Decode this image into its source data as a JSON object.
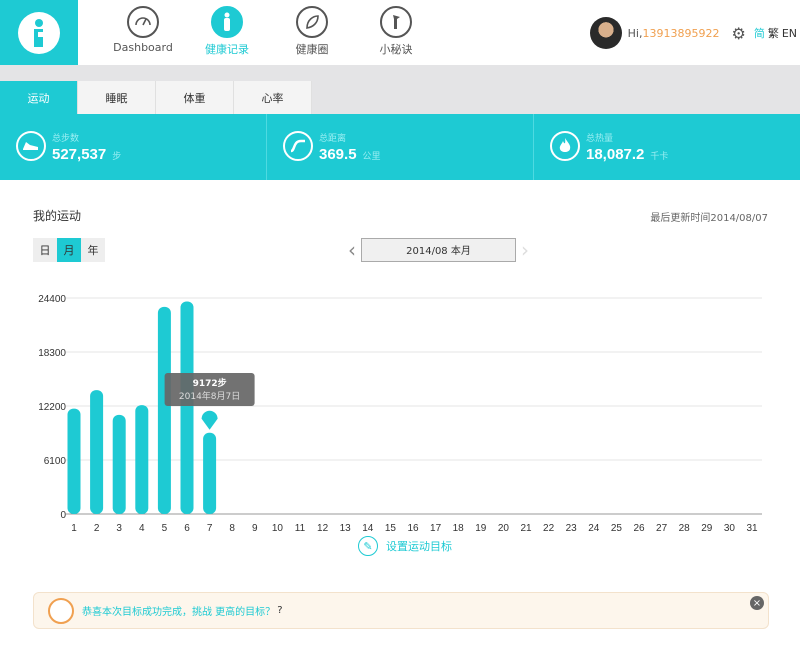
{
  "nav": {
    "items": [
      {
        "label": "Dashboard",
        "icon": "gauge-icon"
      },
      {
        "label": "健康记录",
        "icon": "body-icon"
      },
      {
        "label": "健康圈",
        "icon": "leaf-icon"
      },
      {
        "label": "小秘诀",
        "icon": "tip-icon"
      }
    ]
  },
  "user": {
    "greeting": "Hi,",
    "phone": "13913895922",
    "lang_simplified": "简",
    "lang_traditional": "繁",
    "lang_en": "EN"
  },
  "tabs": [
    "运动",
    "睡眠",
    "体重",
    "心率"
  ],
  "stats": [
    {
      "label": "总步数",
      "value": "527,537",
      "unit": "步",
      "icon": "shoe-icon"
    },
    {
      "label": "总距离",
      "value": "369.5",
      "unit": "公里",
      "icon": "road-icon"
    },
    {
      "label": "总热量",
      "value": "18,087.2",
      "unit": "千卡",
      "icon": "flame-icon"
    }
  ],
  "section": {
    "title": "我的运动",
    "updated": "最后更新时间2014/08/07"
  },
  "range": {
    "day": "日",
    "month": "月",
    "year": "年"
  },
  "date_nav": {
    "label": "2014/08 本月"
  },
  "chart_data": {
    "type": "bar",
    "categories": [
      "1",
      "2",
      "3",
      "4",
      "5",
      "6",
      "7",
      "8",
      "9",
      "10",
      "11",
      "12",
      "13",
      "14",
      "15",
      "16",
      "17",
      "18",
      "19",
      "20",
      "21",
      "22",
      "23",
      "24",
      "25",
      "26",
      "27",
      "28",
      "29",
      "30",
      "31"
    ],
    "values": [
      11900,
      14000,
      11200,
      12300,
      23400,
      24000,
      9172
    ],
    "yticks": [
      0,
      6100,
      12200,
      18300,
      24400
    ],
    "ylim": [
      0,
      24400
    ],
    "tooltip": {
      "value": "9172步",
      "date": "2014年8月7日",
      "index": 6
    },
    "color": "#1ecad3",
    "grid": true
  },
  "goal": {
    "label": "设置运动目标"
  },
  "message": {
    "text": "恭喜本次目标成功完成，挑战 更高的目标？",
    "q": "?"
  },
  "colors": {
    "accent": "#1ecad3",
    "orange": "#f0a050"
  }
}
